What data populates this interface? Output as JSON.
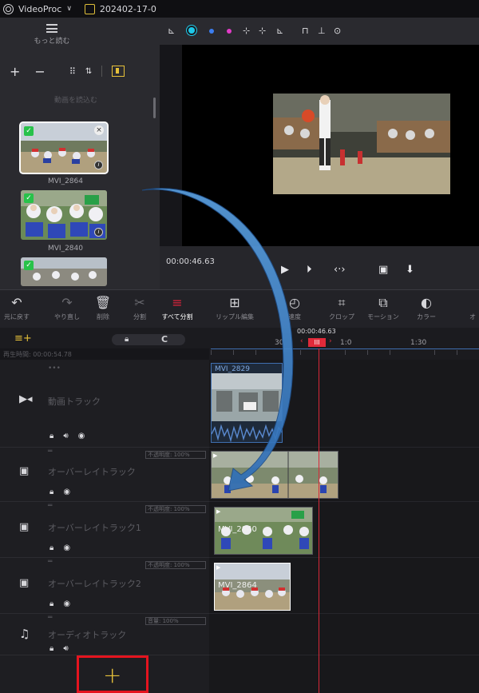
{
  "window": {
    "app_name": "VideoProc",
    "project_name": "202402-17-0"
  },
  "media_panel": {
    "menu_label": "もっと読む",
    "load_hint": "動画を読込む",
    "items": [
      {
        "name": "MVI_2864"
      },
      {
        "name": "MVI_2840"
      },
      {
        "name": ""
      }
    ]
  },
  "preview": {
    "timecode": "00:00:46.63"
  },
  "toolbar": {
    "items": [
      {
        "icon": "undo-icon",
        "label": "元に戻す"
      },
      {
        "icon": "redo-icon",
        "label": "やり直し"
      },
      {
        "icon": "delete-icon",
        "label": "削除"
      },
      {
        "icon": "split-icon",
        "label": "分割"
      },
      {
        "icon": "split-all-icon",
        "label": "すべて分割"
      },
      {
        "icon": "ripple-edit-icon",
        "label": "リップル編集"
      },
      {
        "icon": "speed-icon",
        "label": "速度"
      },
      {
        "icon": "crop-icon",
        "label": "クロップ"
      },
      {
        "icon": "motion-icon",
        "label": "モーション"
      },
      {
        "icon": "color-icon",
        "label": "カラー"
      },
      {
        "icon": "more-icon",
        "label": "オ"
      }
    ]
  },
  "timeline": {
    "duration_label": "再生時間: 00:00:54.78",
    "playhead_time": "00:00:46.63",
    "ruler": [
      "30",
      "1:0",
      "1:30"
    ],
    "tracks": [
      {
        "name": "動画トラック",
        "type": "video",
        "clip_label": "MVI_2829",
        "opacity": ""
      },
      {
        "name": "オーバーレイトラック",
        "type": "overlay",
        "clip_label": "",
        "opacity": "不透明度: 100%"
      },
      {
        "name": "オーバーレイトラック1",
        "type": "overlay",
        "clip_label": "MVI_2840",
        "opacity": "不透明度: 100%"
      },
      {
        "name": "オーバーレイトラック2",
        "type": "overlay",
        "clip_label": "MVI_2864",
        "opacity": "不透明度: 100%"
      },
      {
        "name": "オーディオトラック",
        "type": "audio",
        "clip_label": "",
        "opacity": "音量: 100%"
      }
    ],
    "add_track_symbol": "+"
  },
  "colors": {
    "accent": "#e6c13a",
    "playhead": "#d82838",
    "highlight_box": "#e5141f",
    "arrow": "#3d7fc4"
  }
}
